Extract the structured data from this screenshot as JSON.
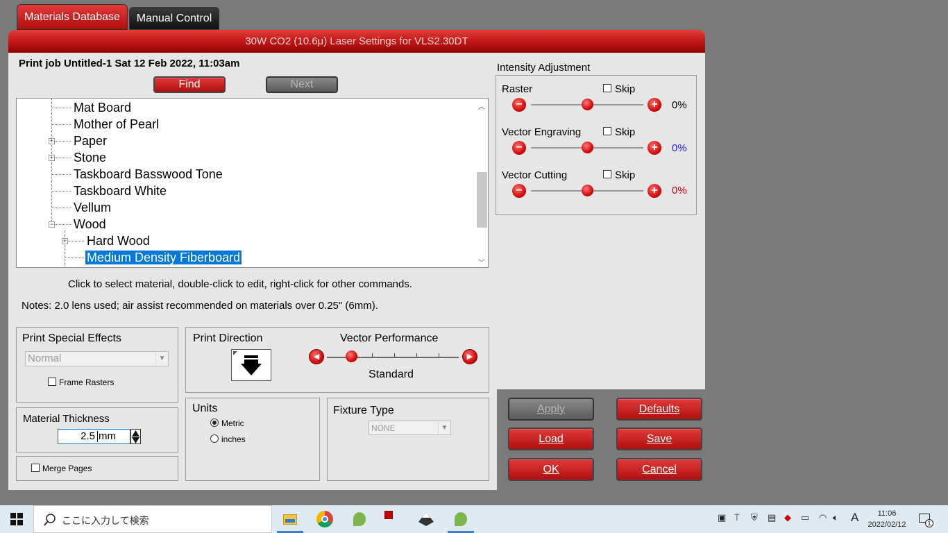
{
  "tabs": {
    "materials": "Materials Database",
    "manual": "Manual Control"
  },
  "window_title": "30W CO2 (10.6μ) Laser Settings for VLS2.30DT",
  "job_title": "Print job Untitled-1 Sat 12 Feb 2022, 11:03am",
  "buttons": {
    "find": "Find",
    "next": "Next",
    "apply": "Apply",
    "defaults": "Defaults",
    "load": "Load",
    "save": "Save",
    "ok": "OK",
    "cancel": "Cancel"
  },
  "tree": {
    "items": [
      {
        "label": "Mat Board",
        "level": 1,
        "expandable": false
      },
      {
        "label": "Mother of Pearl",
        "level": 1,
        "expandable": false
      },
      {
        "label": "Paper",
        "level": 1,
        "expandable": true,
        "expanded": false
      },
      {
        "label": "Stone",
        "level": 1,
        "expandable": true,
        "expanded": false
      },
      {
        "label": "Taskboard Basswood Tone",
        "level": 1,
        "expandable": false
      },
      {
        "label": "Taskboard White",
        "level": 1,
        "expandable": false
      },
      {
        "label": "Vellum",
        "level": 1,
        "expandable": false
      },
      {
        "label": "Wood",
        "level": 1,
        "expandable": true,
        "expanded": true
      },
      {
        "label": "Hard Wood",
        "level": 2,
        "expandable": true,
        "expanded": false
      },
      {
        "label": "Medium Density Fiberboard",
        "level": 2,
        "expandable": false,
        "selected": true
      }
    ]
  },
  "hint": "Click to select material, double-click to edit, right-click for other commands.",
  "notes": "Notes: 2.0 lens used; air assist recommended on materials over 0.25\" (6mm).",
  "intensity": {
    "title": "Intensity Adjustment",
    "skip_label": "Skip",
    "raster": {
      "label": "Raster",
      "value": "0%",
      "level": 0.5,
      "color": "#000000"
    },
    "vector_engraving": {
      "label": "Vector Engraving",
      "value": "0%",
      "level": 0.5,
      "color": "#1a1aff"
    },
    "vector_cutting": {
      "label": "Vector Cutting",
      "value": "0%",
      "level": 0.5,
      "color": "#cc0000"
    }
  },
  "special_effects": {
    "title": "Print Special Effects",
    "selected": "Normal",
    "frame_rasters": "Frame Rasters"
  },
  "print_direction": {
    "title": "Print Direction"
  },
  "vector_performance": {
    "title": "Vector Performance",
    "value": "Standard"
  },
  "thickness": {
    "title": "Material Thickness",
    "value": "2.5",
    "unit": "mm"
  },
  "merge_pages": "Merge Pages",
  "units": {
    "title": "Units",
    "metric": "Metric",
    "inches": "inches",
    "selected": "Metric"
  },
  "fixture": {
    "title": "Fixture Type",
    "selected": "NONE"
  },
  "taskbar": {
    "search_placeholder": "ここに入力して検索",
    "ime": "A",
    "time": "11:06",
    "date": "2022/02/12",
    "notification_count": "1"
  }
}
